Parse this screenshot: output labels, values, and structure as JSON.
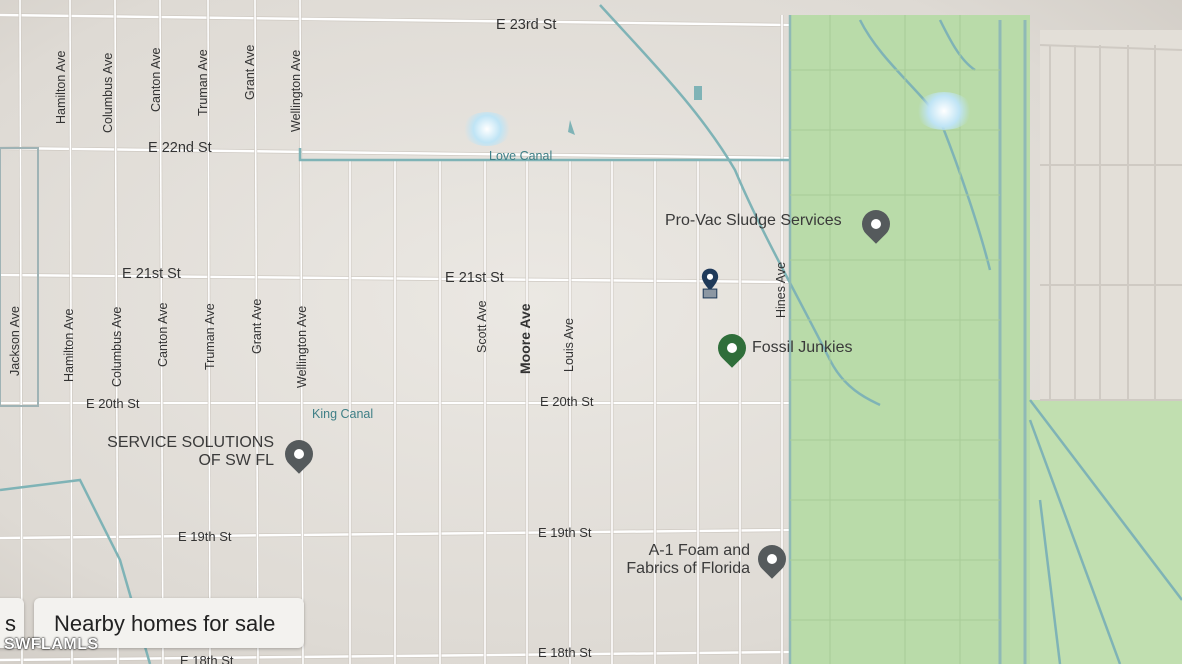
{
  "streets": {
    "e23rd": "E 23rd St",
    "e22nd": "E 22nd St",
    "e21st_west": "E 21st St",
    "e21st_mid": "E 21st St",
    "e20th_west": "E 20th St",
    "e20th_mid": "E 20th St",
    "e19th_west": "E 19th St",
    "e19th_mid": "E 19th St",
    "e18th_west": "E 18th St",
    "e18th_mid": "E 18th St"
  },
  "avenues_north": [
    "Hamilton Ave",
    "Columbus Ave",
    "Canton Ave",
    "Truman Ave",
    "Grant Ave",
    "Wellington Ave"
  ],
  "avenues_south": [
    "Jackson Ave",
    "Hamilton Ave",
    "Columbus Ave",
    "Canton Ave",
    "Truman Ave",
    "Grant Ave",
    "Wellington Ave"
  ],
  "avenues_mid": {
    "scott": "Scott Ave",
    "moore": "Moore Ave",
    "louis": "Louis Ave",
    "hines": "Hines Ave"
  },
  "water": {
    "love_canal": "Love Canal",
    "king_canal": "King Canal"
  },
  "pois": {
    "pro_vac": "Pro-Vac Sludge Services",
    "fossil": "Fossil Junkies",
    "service_line1": "SERVICE SOLUTIONS",
    "service_line2": "OF SW FL",
    "foam_line1": "A-1 Foam and",
    "foam_line2": "Fabrics of Florida"
  },
  "nearby_button": "Nearby homes for sale",
  "partial_button": "s",
  "watermark": "SWFLAMLS",
  "colors": {
    "road": "#ffffff",
    "road_edge": "#c9c5bf",
    "water": "#7fb3b6",
    "park": "#b5d8a6",
    "pin_grey": "#555a5c",
    "pin_green": "#2f6e3a",
    "marker": "#1f3a5a"
  }
}
